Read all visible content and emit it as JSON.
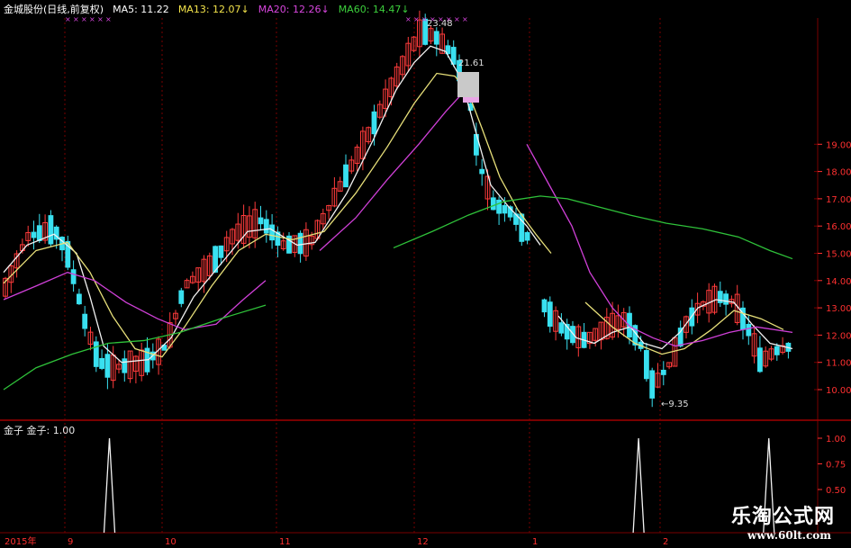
{
  "header": {
    "title": "金城股份(日线,前复权)",
    "ma5": "MA5: 11.22",
    "ma13": "MA13: 12.07↓",
    "ma20": "MA20: 12.26↓",
    "ma60": "MA60: 14.47↓"
  },
  "sub_header": {
    "label": "金子  金子: 1.00"
  },
  "annotations": {
    "high_label": "23.48",
    "mid_label": "21.61",
    "low_label": "9.35"
  },
  "watermark": {
    "cn": "乐淘公式网",
    "url": "www.60lt.com"
  },
  "colors": {
    "background": "#000000",
    "up_candle": "#ff3b3b",
    "down_candle": "#39e0f0",
    "ma5": "#f2f2f2",
    "ma13": "#e8e07a",
    "ma20": "#d040d8",
    "ma60": "#2fc23a",
    "grid": "#7a0000",
    "axis_text": "#ff3030"
  },
  "chart_data": [
    {
      "type": "candlestick",
      "title": "金城股份(日线,前复权)",
      "y_axis_ticks": [
        "19.00",
        "18.00",
        "17.00",
        "16.00",
        "15.00",
        "14.00",
        "13.00",
        "12.00",
        "11.00",
        "10.00"
      ],
      "x_axis_ticks": [
        "2015年",
        "9",
        "10",
        "11",
        "12",
        "1",
        "2"
      ],
      "series": [
        {
          "name": "MA5",
          "value": 11.22
        },
        {
          "name": "MA13",
          "value": 12.07
        },
        {
          "name": "MA20",
          "value": 12.26
        },
        {
          "name": "MA60",
          "value": 14.47
        }
      ],
      "annotations": [
        {
          "label": "23.48",
          "kind": "high"
        },
        {
          "label": "21.61",
          "kind": "marker"
        },
        {
          "label": "9.35",
          "kind": "low"
        }
      ]
    },
    {
      "type": "line",
      "title": "金子",
      "y_axis_ticks": [
        "1.00",
        "0.75",
        "0.50"
      ],
      "series": [
        {
          "name": "金子",
          "value": 1.0
        }
      ],
      "signals_at_x_fraction": [
        0.13,
        0.78,
        0.94
      ]
    }
  ]
}
